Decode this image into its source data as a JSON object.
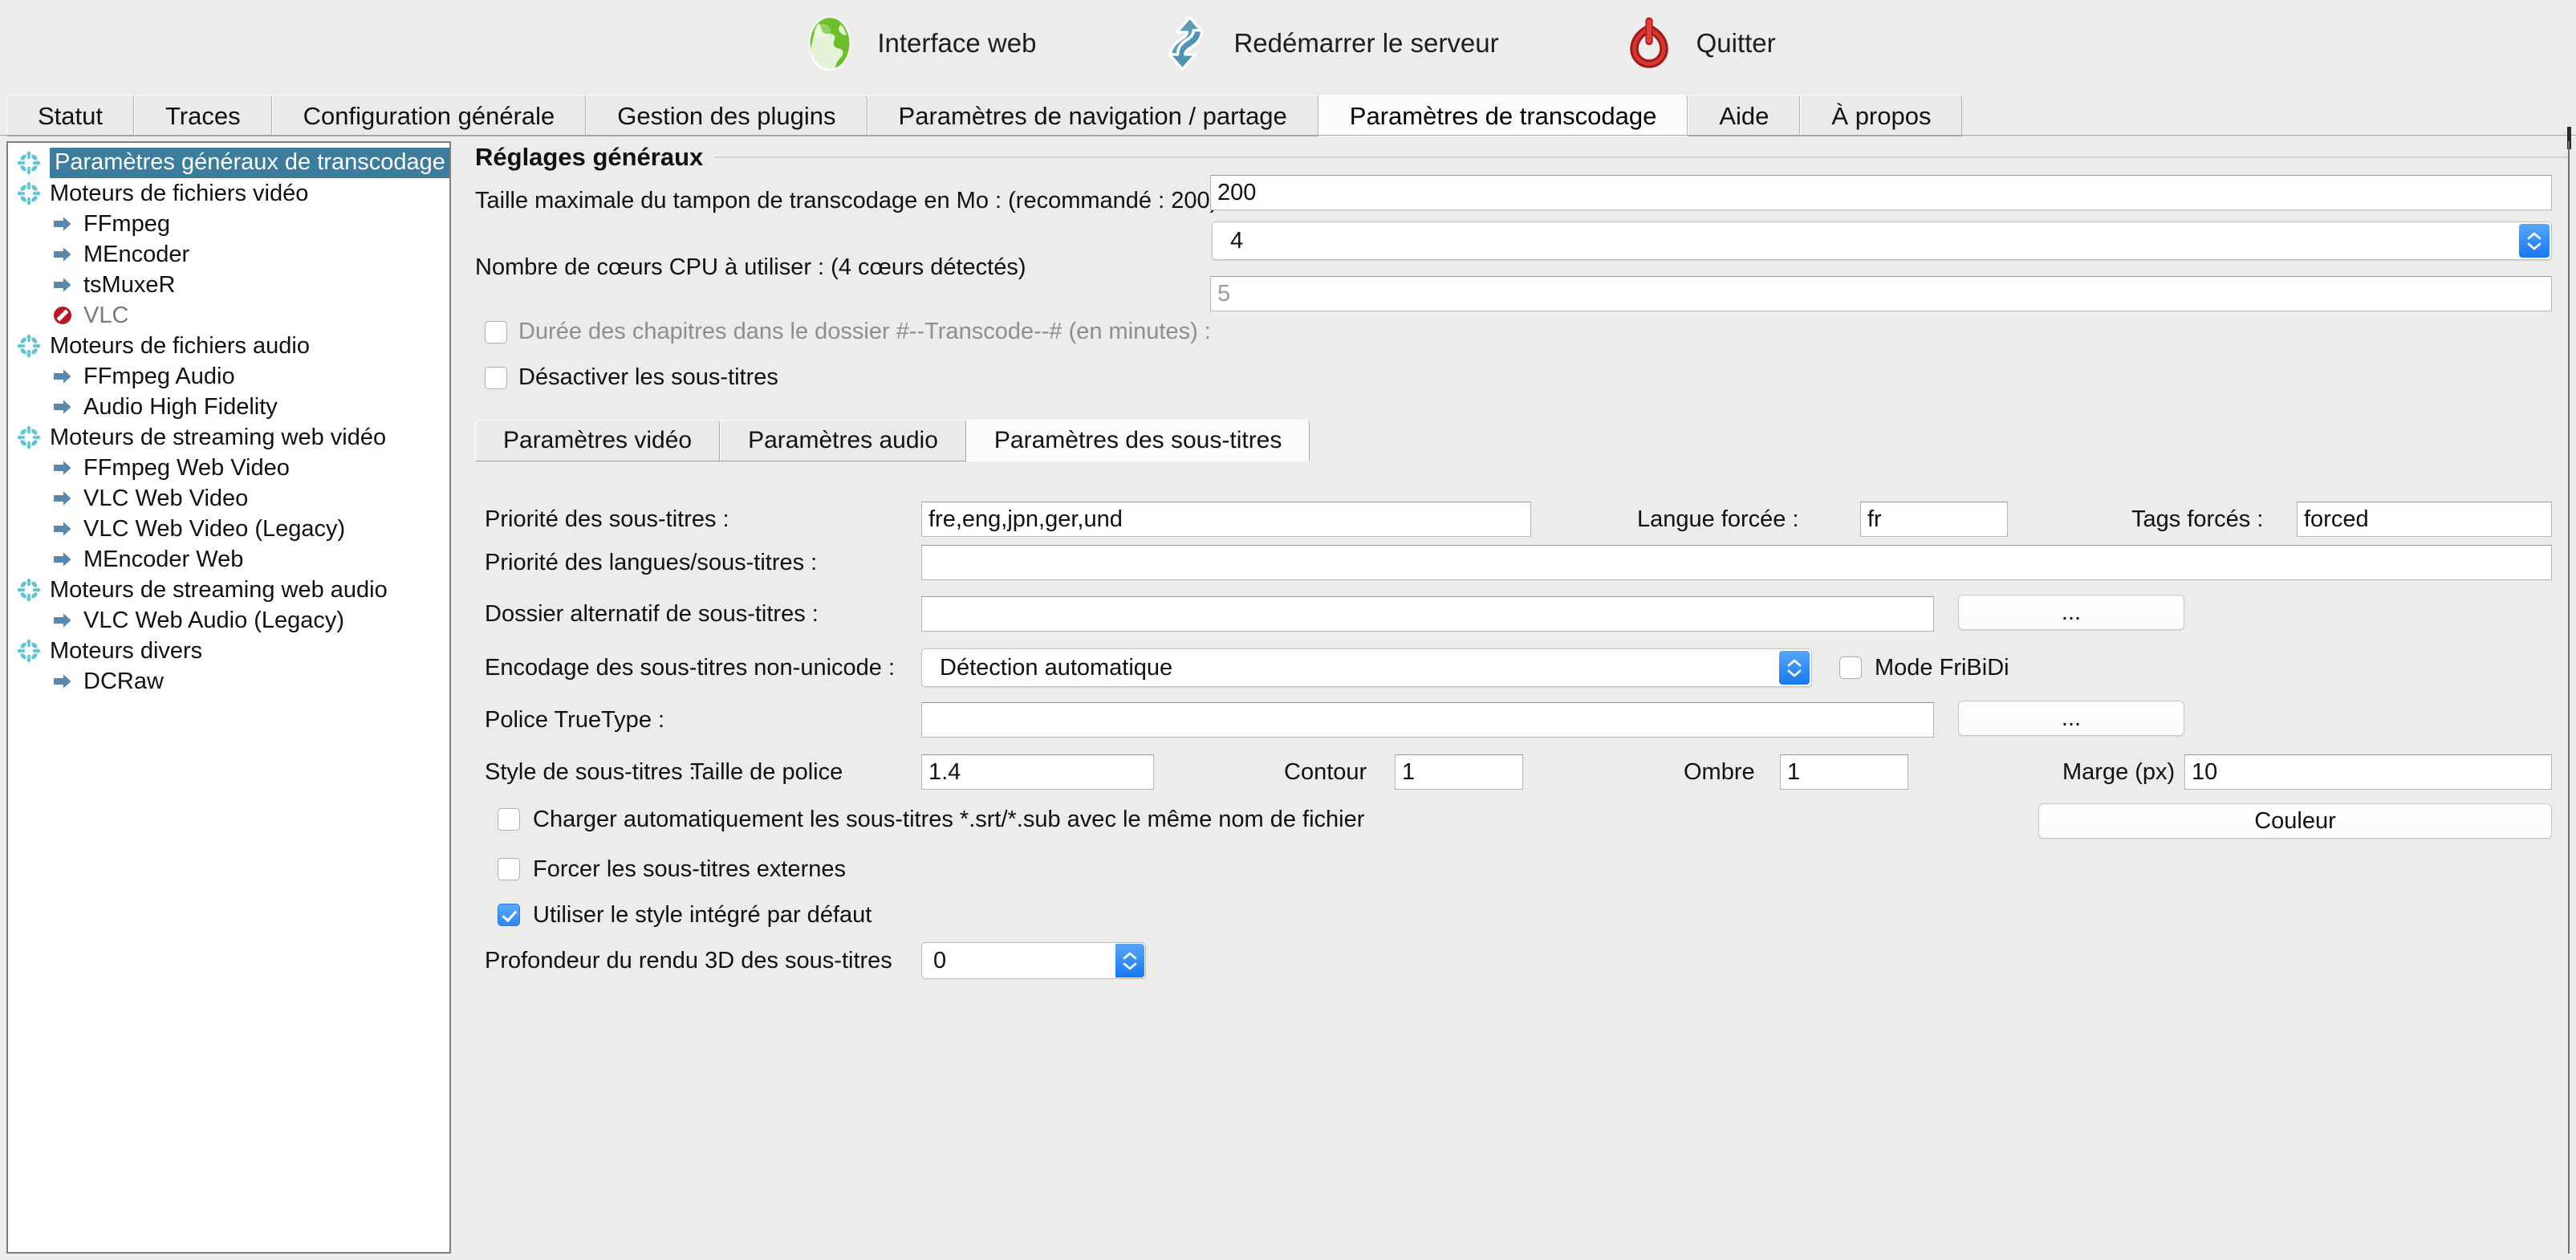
{
  "toolbar": {
    "buttons": [
      {
        "label": "Interface web",
        "icon": "globe-icon"
      },
      {
        "label": "Redémarrer le serveur",
        "icon": "restart-arrows-icon"
      },
      {
        "label": "Quitter",
        "icon": "power-icon"
      }
    ]
  },
  "tabs": [
    {
      "label": "Statut",
      "active": false
    },
    {
      "label": "Traces",
      "active": false
    },
    {
      "label": "Configuration générale",
      "active": false
    },
    {
      "label": "Gestion des plugins",
      "active": false
    },
    {
      "label": "Paramètres de navigation / partage",
      "active": false
    },
    {
      "label": "Paramètres de transcodage",
      "active": true
    },
    {
      "label": "Aide",
      "active": false
    },
    {
      "label": "À propos",
      "active": false
    }
  ],
  "sidebar": {
    "items": [
      {
        "label": "Paramètres généraux de transcodage",
        "icon": "asterisk-icon",
        "child": false,
        "selected": true
      },
      {
        "label": "Moteurs de fichiers vidéo",
        "icon": "asterisk-icon",
        "child": false,
        "selected": false
      },
      {
        "label": "FFmpeg",
        "icon": "arrow-icon",
        "child": true,
        "selected": false
      },
      {
        "label": "MEncoder",
        "icon": "arrow-icon",
        "child": true,
        "selected": false
      },
      {
        "label": "tsMuxeR",
        "icon": "arrow-icon",
        "child": true,
        "selected": false
      },
      {
        "label": "VLC",
        "icon": "disabled-icon",
        "child": true,
        "selected": false,
        "disabled": true
      },
      {
        "label": "Moteurs de fichiers audio",
        "icon": "asterisk-icon",
        "child": false,
        "selected": false
      },
      {
        "label": "FFmpeg Audio",
        "icon": "arrow-icon",
        "child": true,
        "selected": false
      },
      {
        "label": "Audio High Fidelity",
        "icon": "arrow-icon",
        "child": true,
        "selected": false
      },
      {
        "label": "Moteurs de streaming web vidéo",
        "icon": "asterisk-icon",
        "child": false,
        "selected": false
      },
      {
        "label": "FFmpeg Web Video",
        "icon": "arrow-icon",
        "child": true,
        "selected": false
      },
      {
        "label": "VLC Web Video",
        "icon": "arrow-icon",
        "child": true,
        "selected": false
      },
      {
        "label": "VLC Web Video (Legacy)",
        "icon": "arrow-icon",
        "child": true,
        "selected": false
      },
      {
        "label": "MEncoder Web",
        "icon": "arrow-icon",
        "child": true,
        "selected": false
      },
      {
        "label": "Moteurs de streaming web audio",
        "icon": "asterisk-icon",
        "child": false,
        "selected": false
      },
      {
        "label": "VLC Web Audio (Legacy)",
        "icon": "arrow-icon",
        "child": true,
        "selected": false
      },
      {
        "label": "Moteurs divers",
        "icon": "asterisk-icon",
        "child": false,
        "selected": false
      },
      {
        "label": "DCRaw",
        "icon": "arrow-icon",
        "child": true,
        "selected": false
      }
    ]
  },
  "general": {
    "section_title": "Réglages généraux",
    "buffer_label": "Taille maximale du tampon de transcodage en Mo : (recommandé : 200)",
    "buffer_value": "200",
    "cores_label": "Nombre de cœurs CPU à utiliser : (4 cœurs détectés)",
    "cores_value": "4",
    "chapters_label": "Durée des chapitres dans le dossier #--Transcode--# (en minutes) :",
    "chapters_value": "5",
    "chapters_checked": false,
    "disable_subs_label": "Désactiver les sous-titres",
    "disable_subs_checked": false
  },
  "inner_tabs": [
    {
      "label": "Paramètres vidéo",
      "active": false
    },
    {
      "label": "Paramètres audio",
      "active": false
    },
    {
      "label": "Paramètres des sous-titres",
      "active": true
    }
  ],
  "subtitles": {
    "priority_label": "Priorité des sous-titres :",
    "priority_value": "fre,eng,jpn,ger,und",
    "forced_lang_label": "Langue forcée :",
    "forced_lang_value": "fr",
    "forced_tags_label": "Tags forcés :",
    "forced_tags_value": "forced",
    "lang_priority_label": "Priorité des langues/sous-titres :",
    "lang_priority_value": "",
    "alt_folder_label": "Dossier alternatif de sous-titres :",
    "alt_folder_value": "",
    "alt_folder_browse": "...",
    "encoding_label": "Encodage des sous-titres non-unicode :",
    "encoding_value": "Détection automatique",
    "fribidi_label": "Mode FriBiDi",
    "fribidi_checked": false,
    "truetype_label": "Police TrueType :",
    "truetype_value": "",
    "truetype_browse": "...",
    "style_label": "Style de sous-titres :",
    "font_size_label": "Taille de police",
    "font_size_value": "1.4",
    "outline_label": "Contour",
    "outline_value": "1",
    "shadow_label": "Ombre",
    "shadow_value": "1",
    "margin_label": "Marge (px)",
    "margin_value": "10",
    "color_button": "Couleur",
    "autoload_label": "Charger automatiquement les sous-titres *.srt/*.sub avec le même nom de fichier",
    "autoload_checked": false,
    "force_external_label": "Forcer les sous-titres externes",
    "force_external_checked": false,
    "embedded_style_label": "Utiliser le style intégré par défaut",
    "embedded_style_checked": true,
    "depth3d_label": "Profondeur du rendu 3D des sous-titres",
    "depth3d_value": "0"
  },
  "colors": {
    "selection_blue": "#3c7c9c",
    "accent_blue": "#2f86f2",
    "window_bg": "#ececeb",
    "field_bg": "#ffffff"
  }
}
